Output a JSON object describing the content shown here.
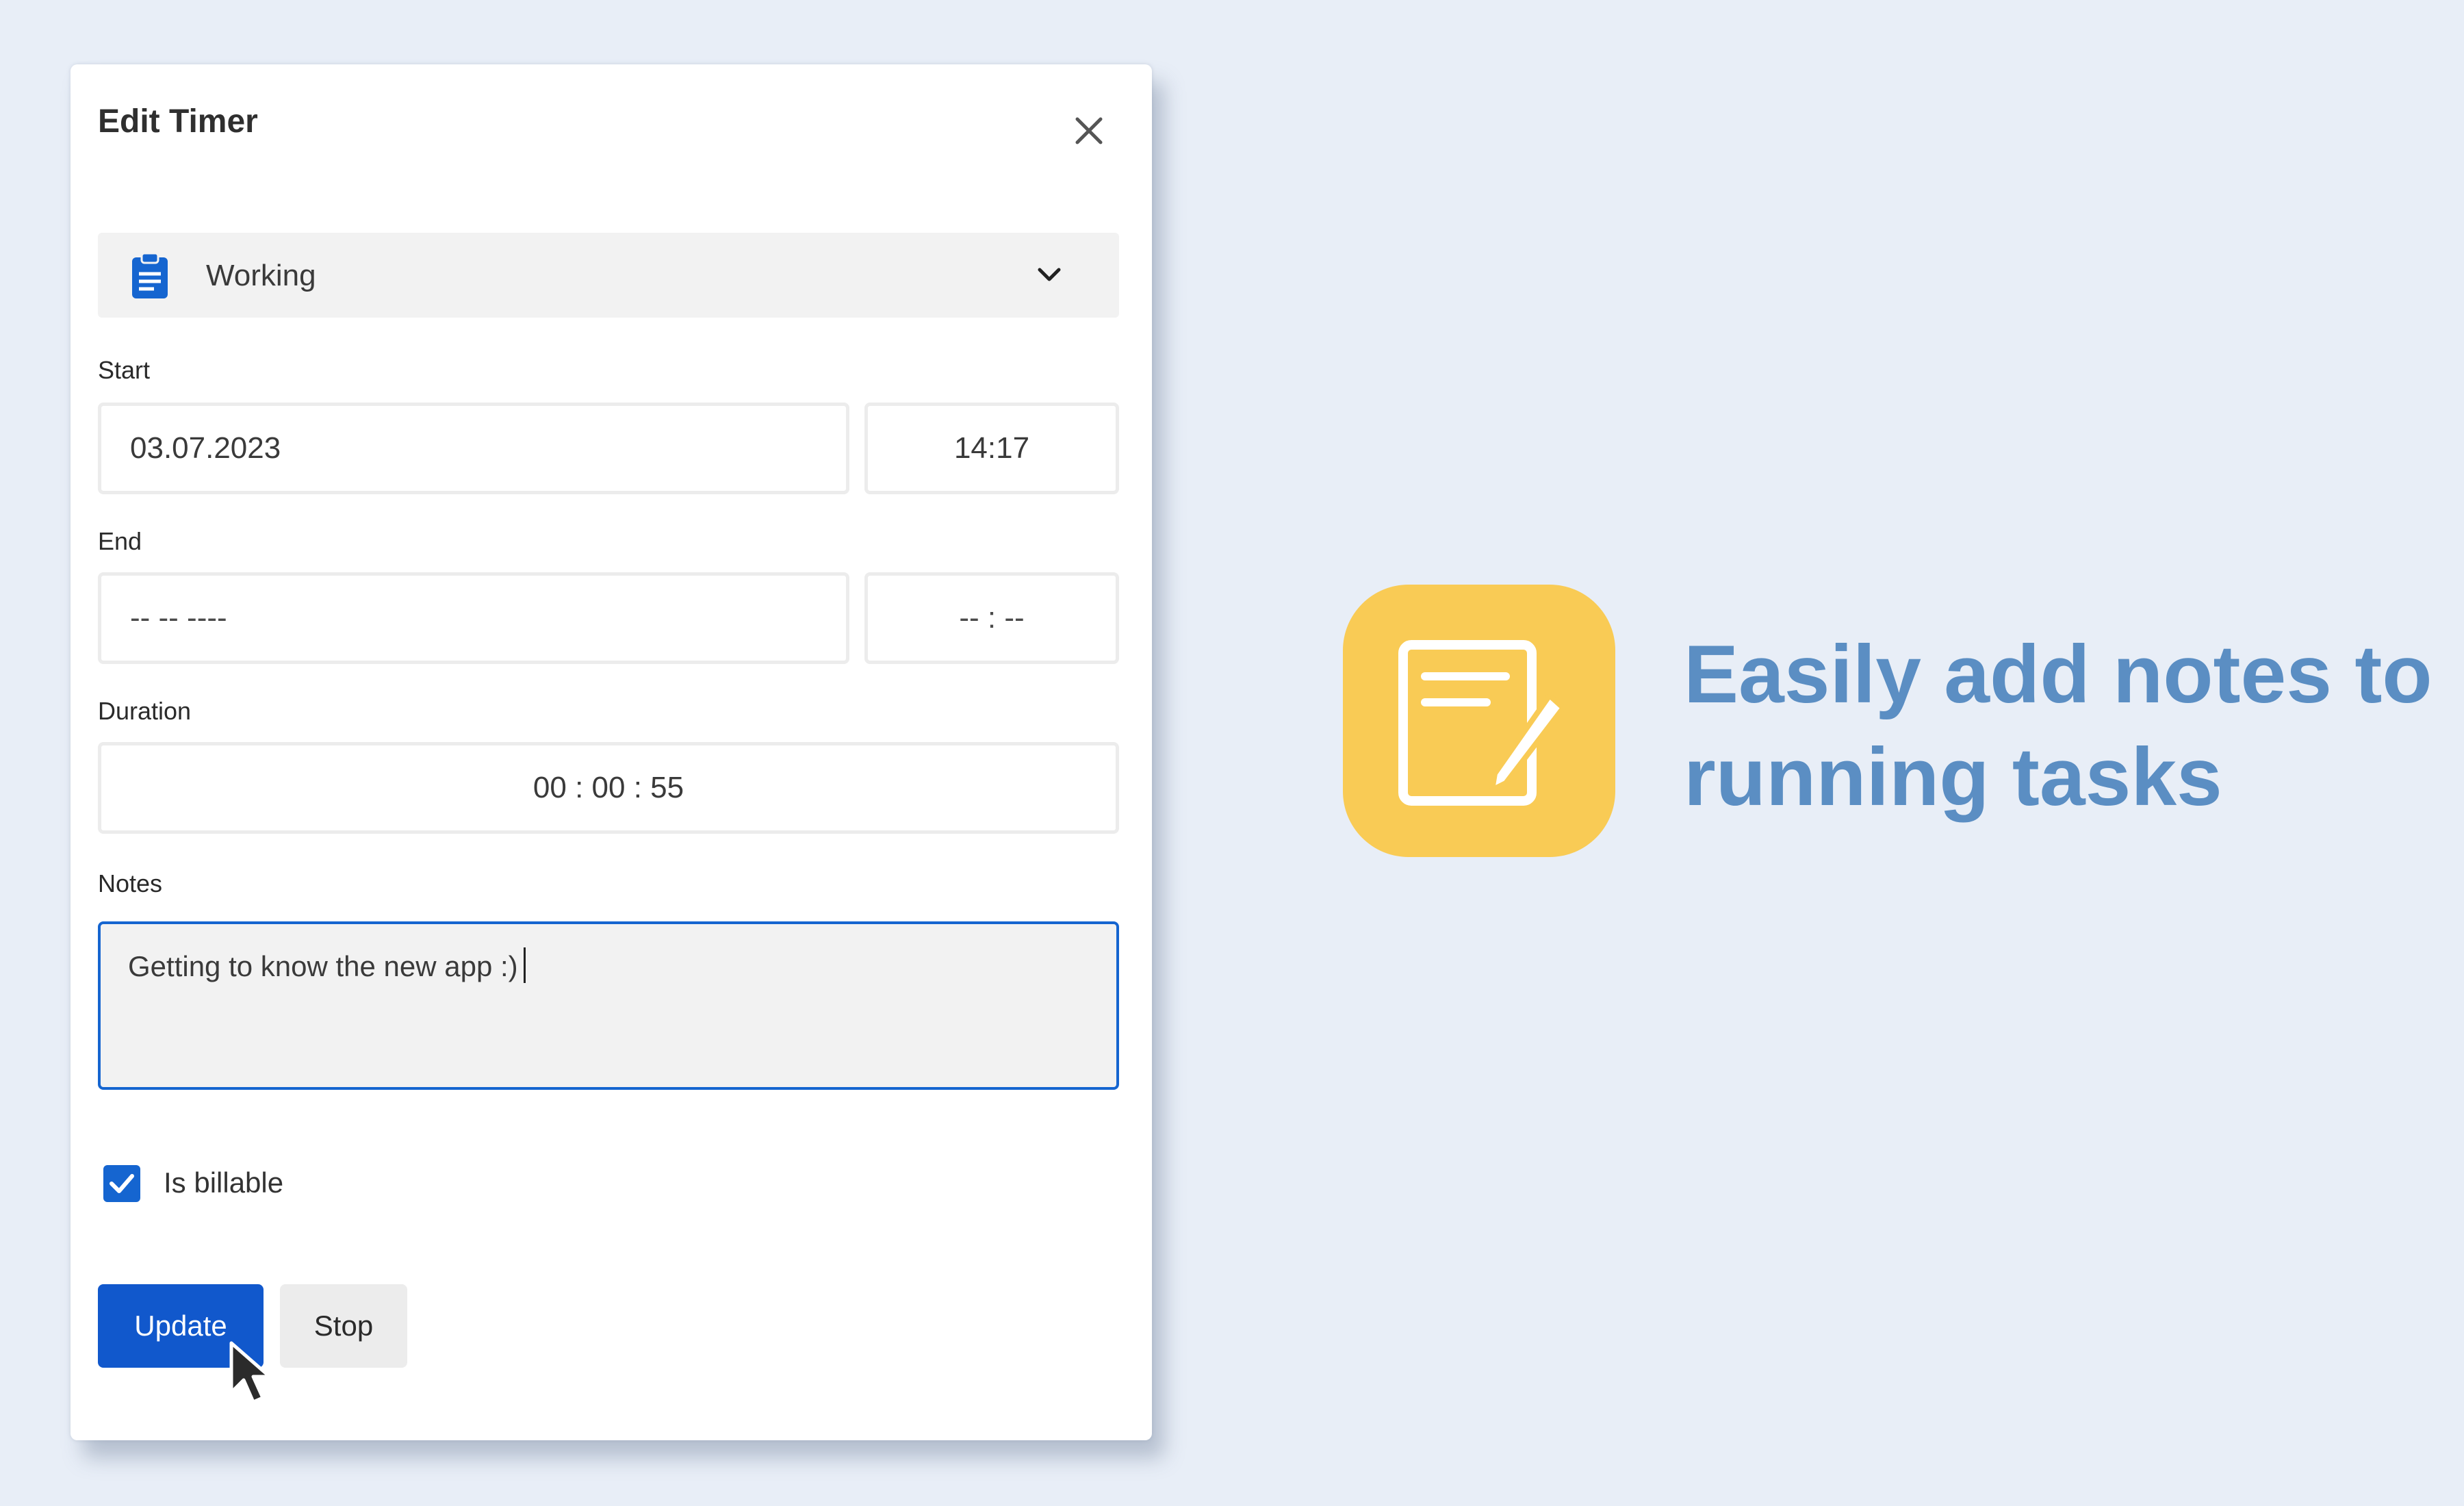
{
  "dialog": {
    "title": "Edit Timer",
    "close_icon": "close-icon",
    "task": {
      "icon": "clipboard-icon",
      "label": "Working",
      "chevron": "chevron-down-icon"
    },
    "start": {
      "label": "Start",
      "date": "03.07.2023",
      "time": "14:17"
    },
    "end": {
      "label": "End",
      "date_placeholder": "-- -- ----",
      "time_placeholder": "-- : --"
    },
    "duration": {
      "label": "Duration",
      "value": "00 : 00 : 55"
    },
    "notes": {
      "label": "Notes",
      "value": "Getting to know the new app :)"
    },
    "billable": {
      "label": "Is billable",
      "checked": true
    },
    "buttons": {
      "update": "Update",
      "stop": "Stop"
    }
  },
  "promo": {
    "icon": "note-edit-icon",
    "icon_color": "#f9cb55",
    "headline_line1": "Easily add notes to",
    "headline_line2": "running tasks",
    "headline_color": "#5b8ec3"
  },
  "colors": {
    "accent": "#1565d0",
    "background": "#e8eef7"
  }
}
